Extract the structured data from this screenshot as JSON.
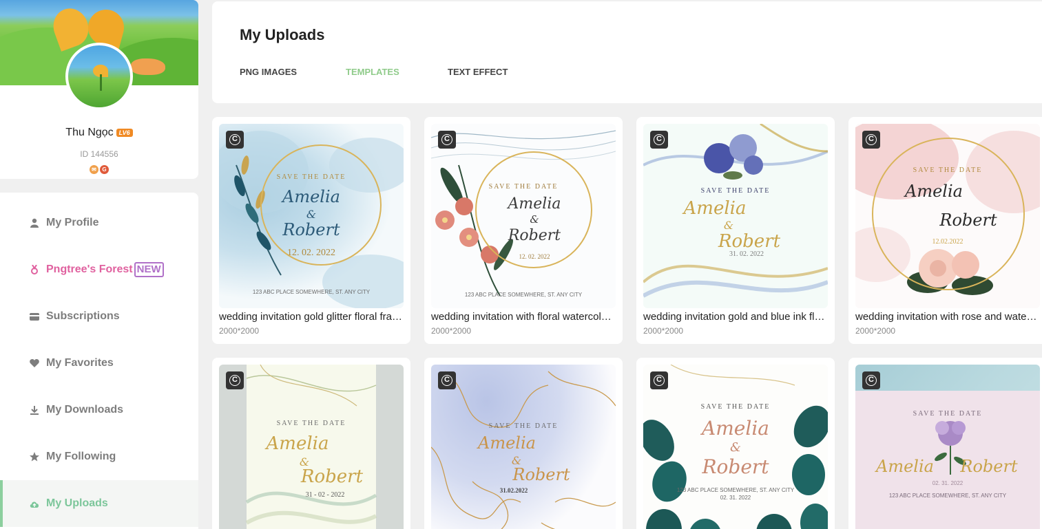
{
  "profile": {
    "name": "Thu Ngọc",
    "level": "LV6",
    "id_text": "ID 144556"
  },
  "menu": [
    {
      "label": "My Profile",
      "icon": "user-icon"
    },
    {
      "label": "Pngtree's Forest",
      "icon": "medal-icon",
      "tag": "NEW"
    },
    {
      "label": "Subscriptions",
      "icon": "card-icon"
    },
    {
      "label": "My Favorites",
      "icon": "heart-icon"
    },
    {
      "label": "My Downloads",
      "icon": "download-icon"
    },
    {
      "label": "My Following",
      "icon": "star-icon"
    },
    {
      "label": "My Uploads",
      "icon": "cloud-upload-icon"
    }
  ],
  "header": {
    "title": "My Uploads",
    "tabs": [
      "PNG IMAGES",
      "TEMPLATES",
      "TEXT EFFECT"
    ],
    "active_tab": "TEMPLATES"
  },
  "cards": [
    {
      "title": "wedding invitation gold glitter floral frame",
      "size": "2000*2000",
      "save": "SAVE THE DATE",
      "name1": "Amelia",
      "amp": "&",
      "name2": "Robert",
      "date": "12. 02. 2022",
      "address": "123 ABC PLACE SOMEWHERE, ST. ANY CITY"
    },
    {
      "title": "wedding invitation with floral watercolor orchid",
      "size": "2000*2000",
      "save": "SAVE THE DATE",
      "name1": "Amelia",
      "amp": "&",
      "name2": "Robert",
      "date": "12. 02. 2022",
      "address": "123 ABC PLACE SOMEWHERE, ST. ANY CITY"
    },
    {
      "title": "wedding invitation gold and blue ink flowers",
      "size": "2000*2000",
      "save": "SAVE THE DATE",
      "name1": "Amelia",
      "amp": "&",
      "name2": "Robert",
      "date": "31. 02. 2022",
      "address": ""
    },
    {
      "title": "wedding invitation with rose and watercolor",
      "size": "2000*2000",
      "save": "SAVE THE DATE",
      "name1": "Amelia",
      "amp": "&",
      "name2": "Robert",
      "date": "12.02.2022",
      "address": ""
    },
    {
      "save": "SAVE THE DATE",
      "name1": "Amelia",
      "amp": "&",
      "name2": "Robert",
      "date": "31 - 02 - 2022",
      "address": ""
    },
    {
      "save": "SAVE THE DATE",
      "name1": "Amelia",
      "amp": "&",
      "name2": "Robert",
      "date": "31.02.2022",
      "address": ""
    },
    {
      "save": "SAVE THE DATE",
      "name1": "Amelia",
      "amp": "&",
      "name2": "Robert",
      "date": "02. 31. 2022",
      "address": "123 ABC PLACE SOMEWHERE, ST. ANY CITY"
    },
    {
      "save": "SAVE THE DATE",
      "name1": "Amelia",
      "amp": "&",
      "name2": "Robert",
      "date": "02. 31. 2022",
      "address": "123 ABC PLACE SOMEWHERE, ST. ANY CITY"
    }
  ],
  "colors": {
    "active_green": "#8fcb8a",
    "forest_pink": "#e0619f",
    "new_purple": "#b070c8",
    "gold": "#d9b45a"
  }
}
